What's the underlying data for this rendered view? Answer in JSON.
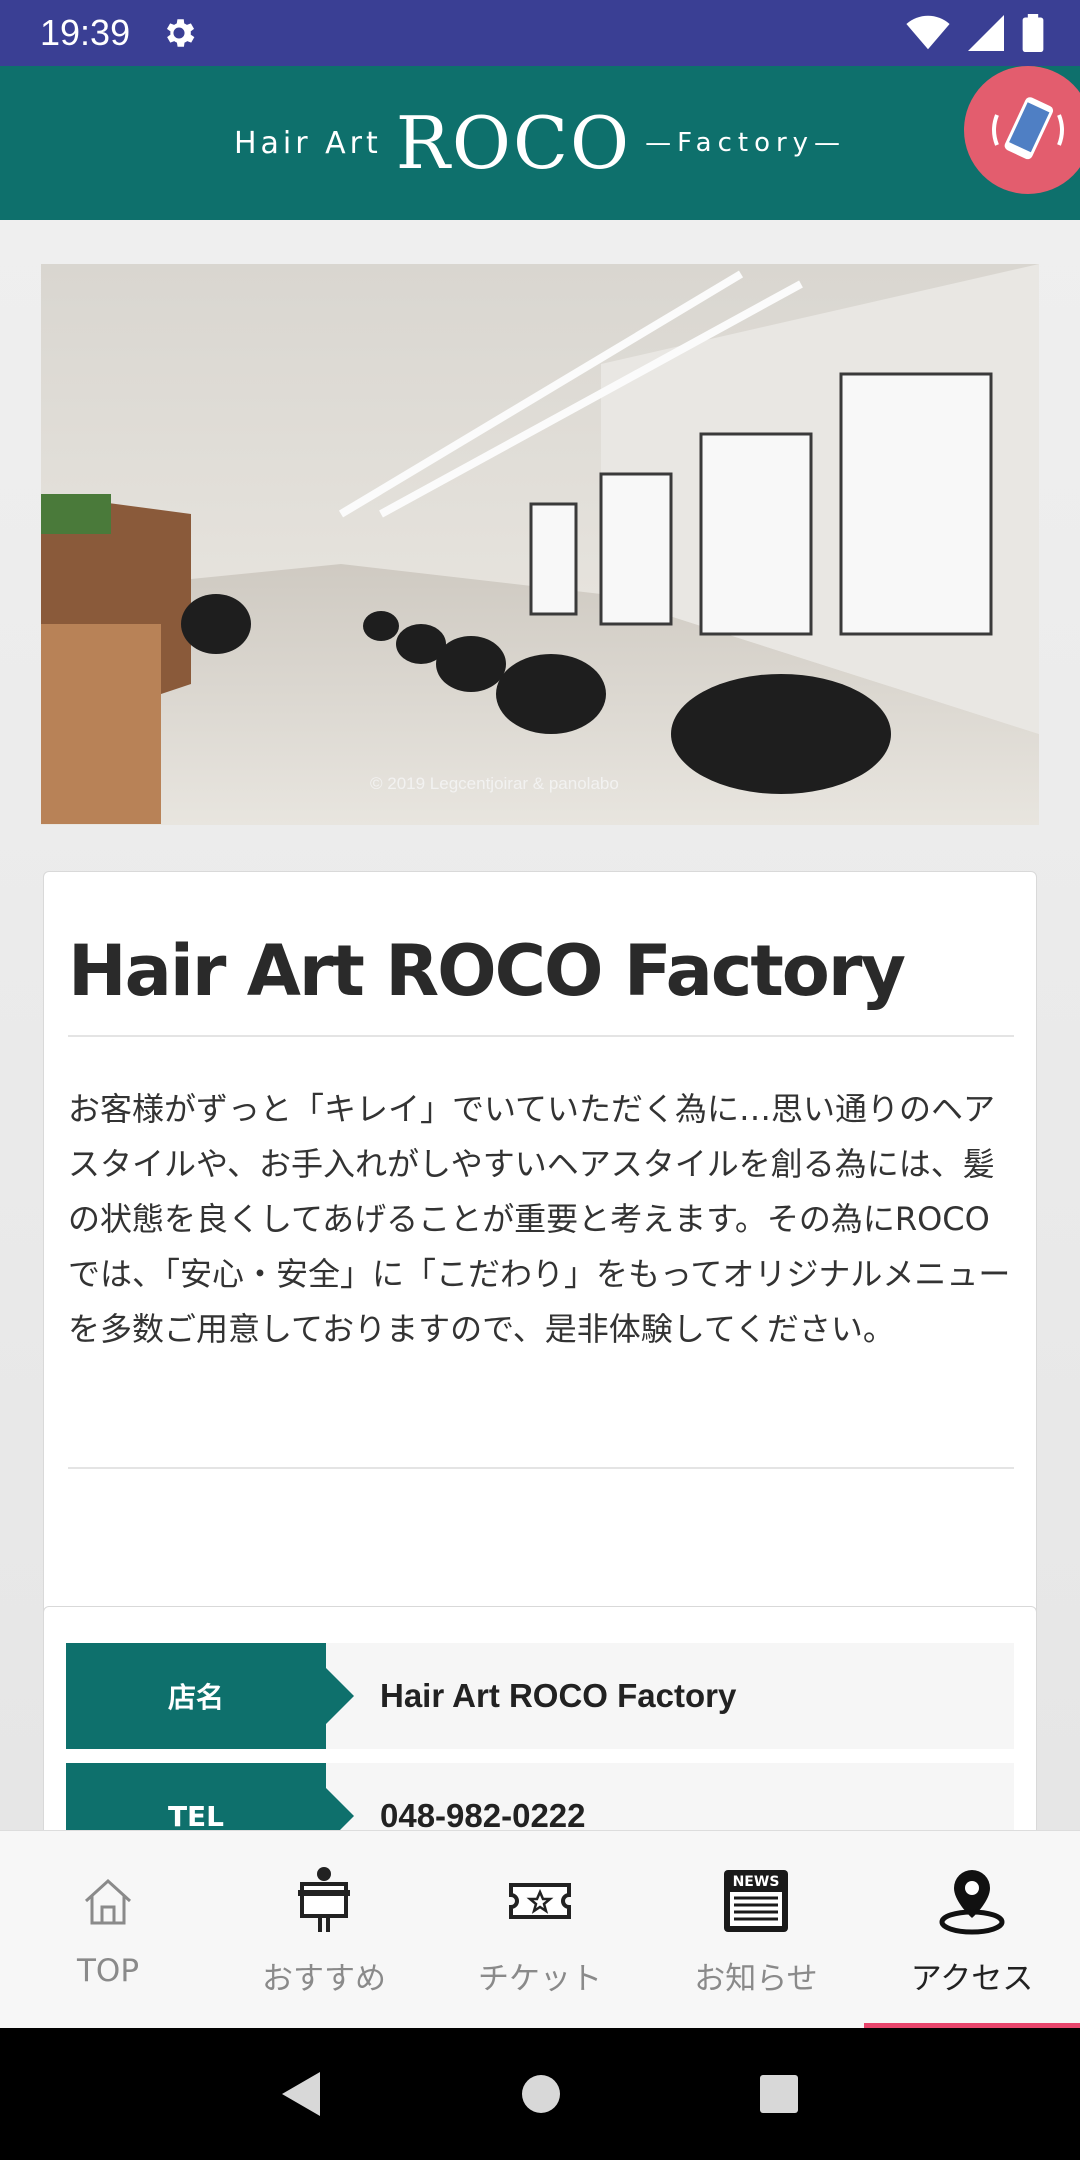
{
  "status": {
    "time": "19:39"
  },
  "header": {
    "logo_small": "Hair Art",
    "logo_big": "ROCO",
    "logo_sub": "—Factory—"
  },
  "photo": {
    "credit": "© 2019 Legcentjoirar & panolabo"
  },
  "shop": {
    "title": "Hair Art ROCO Factory",
    "description": "お客様がずっと「キレイ」でいていただく為に…思い通りのヘアスタイルや、お手入れがしやすいヘアスタイルを創る為には、髪の状態を良くしてあげることが重要と考えます。その為にROCOでは、「安心・安全」に「こだわり」をもってオリジナルメニューを多数ご用意しておりますので、是非体験してください。"
  },
  "info": [
    {
      "label": "店名",
      "value": "Hair Art ROCO Factory"
    },
    {
      "label": "TEL",
      "value": "048-982-0222"
    }
  ],
  "tabs": [
    {
      "label": "TOP",
      "icon": "home-icon"
    },
    {
      "label": "おすすめ",
      "icon": "signboard-icon"
    },
    {
      "label": "チケット",
      "icon": "ticket-icon"
    },
    {
      "label": "お知らせ",
      "icon": "news-icon"
    },
    {
      "label": "アクセス",
      "icon": "map-pin-icon",
      "active": true
    }
  ],
  "colors": {
    "statusbar": "#3a3f94",
    "brand": "#0e706c",
    "accent": "#e8456c",
    "call_button": "#e35d6e"
  }
}
